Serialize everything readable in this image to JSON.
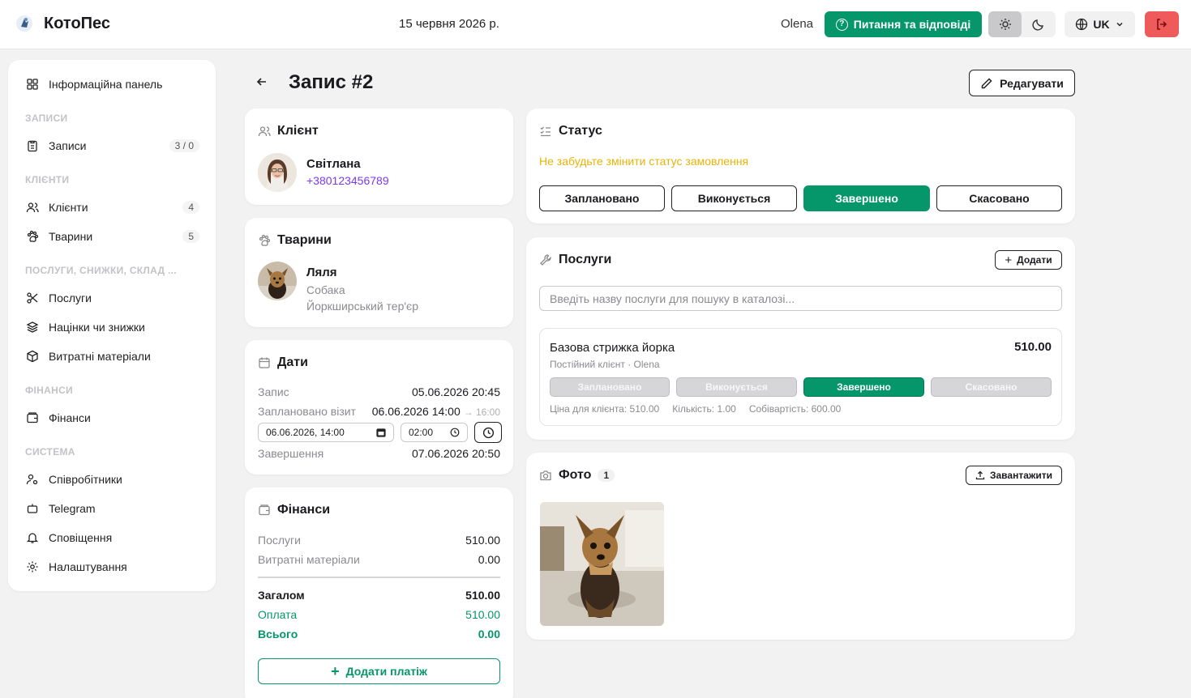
{
  "header": {
    "brand": "КотоПес",
    "date": "15 червня 2026 р.",
    "user": "Olena",
    "faq_label": "Питання та відповіді",
    "lang": "UK"
  },
  "sidebar": {
    "dashboard": "Інформаційна панель",
    "sec_records": "ЗАПИСИ",
    "records": "Записи",
    "records_badge": "3 / 0",
    "sec_clients": "КЛІЄНТИ",
    "clients": "Клієнти",
    "clients_badge": "4",
    "pets": "Тварини",
    "pets_badge": "5",
    "sec_services": "ПОСЛУГИ, СНИЖКИ, СКЛАД ...",
    "services": "Послуги",
    "markups": "Націнки чи знижки",
    "materials": "Витратні матеріали",
    "sec_finance": "ФІНАНСИ",
    "finance": "Фінанси",
    "sec_system": "СИСТЕМА",
    "staff": "Співробітники",
    "telegram": "Telegram",
    "notifications": "Сповіщення",
    "settings": "Налаштування"
  },
  "page": {
    "title": "Запис #2",
    "edit_label": "Редагувати"
  },
  "client": {
    "title": "Клієнт",
    "name": "Світлана",
    "phone": "+380123456789"
  },
  "pets": {
    "title": "Тварини",
    "name": "Ляля",
    "species": "Собака",
    "breed": "Йоркширський тер'єр"
  },
  "dates": {
    "title": "Дати",
    "record_label": "Запис",
    "record_value": "05.06.2026 20:45",
    "planned_label": "Заплановано візит",
    "planned_value": "06.06.2026 14:00",
    "planned_end": "→ 16:00",
    "date_input": "06.06.2026, 14:00",
    "time_input": "02:00",
    "done_label": "Завершення",
    "done_value": "07.06.2026 20:50"
  },
  "finance": {
    "title": "Фінанси",
    "services_label": "Послуги",
    "services_value": "510.00",
    "materials_label": "Витратні матеріали",
    "materials_value": "0.00",
    "total_label": "Загалом",
    "total_value": "510.00",
    "paid_label": "Оплата",
    "paid_value": "510.00",
    "due_label": "Всього",
    "due_value": "0.00",
    "add_payment": "Додати платіж"
  },
  "status": {
    "title": "Статус",
    "reminder": "Не забудьте змінити статус замовлення",
    "options": [
      "Заплановано",
      "Виконується",
      "Завершено",
      "Скасовано"
    ],
    "selected": "Завершено"
  },
  "services": {
    "title": "Послуги",
    "add_label": "Додати",
    "search_placeholder": "Введіть назву послуги для пошуку в каталозі...",
    "item": {
      "name": "Базова стрижка йорка",
      "price": "510.00",
      "meta_client": "Постійний клієнт",
      "meta_staff": "· Olena",
      "statuses": [
        "Заплановано",
        "Виконується",
        "Завершено",
        "Скасовано"
      ],
      "client_price": "Ціна для клієнта: 510.00",
      "qty": "Кількість: 1.00",
      "cost": "Собівартість: 600.00"
    }
  },
  "photos": {
    "title": "Фото",
    "count": "1",
    "upload_label": "Завантажити"
  },
  "colors": {
    "accent": "#059669",
    "warning": "#eab308",
    "phone": "#7c3aed",
    "danger": "#ef5a5a"
  }
}
